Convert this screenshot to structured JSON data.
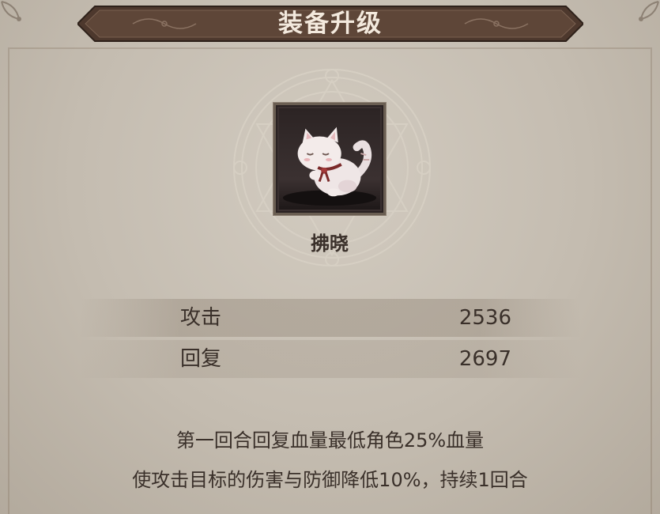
{
  "title": "装备升级",
  "item": {
    "name": "拂晓",
    "icon": "white-cat-icon"
  },
  "stats": [
    {
      "label": "攻击",
      "value": "2536"
    },
    {
      "label": "回复",
      "value": "2697"
    }
  ],
  "description": [
    "第一回合回复血量最低角色25%血量",
    "使攻击目标的伤害与防御降低10%，持续1回合"
  ],
  "colors": {
    "banner": "#5a4235",
    "text": "#3a302a",
    "background": "#c4bcb0"
  }
}
